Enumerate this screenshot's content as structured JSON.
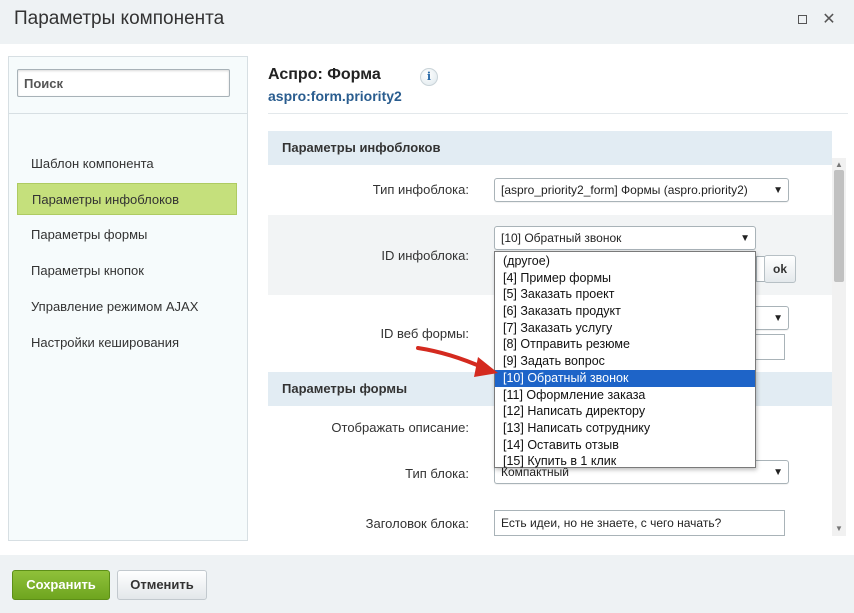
{
  "window": {
    "title": "Параметры компонента",
    "maximize_icon": "maximize-icon",
    "close_icon": "close-icon",
    "close_glyph": "✕"
  },
  "sidebar": {
    "search_placeholder": "Поиск",
    "items": [
      {
        "label": "Шаблон компонента",
        "active": false
      },
      {
        "label": "Параметры инфоблоков",
        "active": true
      },
      {
        "label": "Параметры формы",
        "active": false
      },
      {
        "label": "Параметры кнопок",
        "active": false
      },
      {
        "label": "Управление режимом AJAX",
        "active": false
      },
      {
        "label": "Настройки кеширования",
        "active": false
      }
    ]
  },
  "component": {
    "title": "Аспро: Форма",
    "code": "aspro:form.priority2",
    "info_icon": "info-icon",
    "info_glyph": "i"
  },
  "sections": {
    "infoblocks": {
      "title": "Параметры инфоблоков",
      "iblock_type_label": "Тип инфоблока:",
      "iblock_type_value": "[aspro_priority2_form] Формы (aspro.priority2)",
      "iblock_id_label": "ID инфоблока:",
      "iblock_id_value": "[10] Обратный звонок",
      "ok_label": "ok",
      "webform_id_label": "ID веб формы:"
    },
    "form": {
      "title": "Параметры формы",
      "show_description_label": "Отображать описание:",
      "block_type_label": "Тип блока:",
      "block_type_value": "Компактный",
      "block_title_label": "Заголовок блока:",
      "block_title_value": "Есть идеи, но не знаете, с чего начать?"
    }
  },
  "dropdown": {
    "options": [
      "(другое)",
      "[4] Пример формы",
      "[5] Заказать проект",
      "[6] Заказать продукт",
      "[7] Заказать услугу",
      "[8] Отправить резюме",
      "[9] Задать вопрос",
      "[10] Обратный звонок",
      "[11] Оформление заказа",
      "[12] Написать директору",
      "[13] Написать сотруднику",
      "[14] Оставить отзыв",
      "[15] Купить в 1 клик"
    ],
    "selected": "[10] Обратный звонок"
  },
  "annotation": {
    "arrow_icon": "red-arrow-icon",
    "color": "#d42a1f"
  },
  "footer": {
    "save_label": "Сохранить",
    "cancel_label": "Отменить"
  },
  "colors": {
    "active_item": "#c5e07c",
    "section_header": "#e2ecf3",
    "save_button": "#7ab22a",
    "selected_option": "#1e64c8"
  }
}
